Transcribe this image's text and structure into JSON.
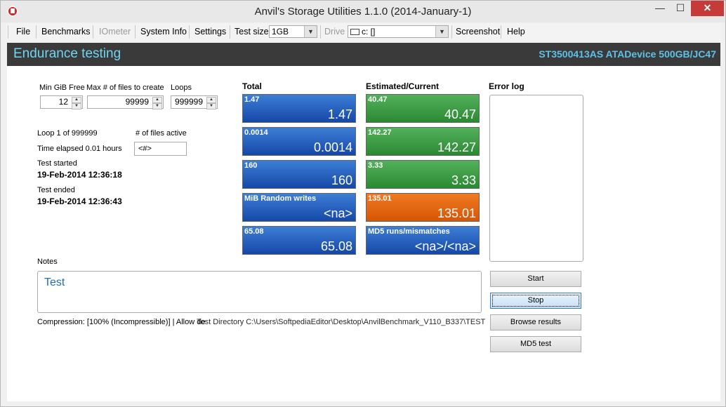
{
  "window": {
    "title": "Anvil's Storage Utilities 1.1.0 (2014-January-1)",
    "min": "—",
    "max": "☐",
    "close": "✕"
  },
  "menu": {
    "file": "File",
    "benchmarks": "Benchmarks",
    "iometer": "IOmeter",
    "sysinfo": "System Info",
    "settings": "Settings",
    "testsize_label": "Test size",
    "testsize_value": "1GB",
    "drive_label": "Drive",
    "drive_value": "c: []",
    "screenshot": "Screenshot",
    "help": "Help"
  },
  "header": {
    "title": "Endurance testing",
    "device": "ST3500413AS ATADevice 500GB/JC47"
  },
  "params": {
    "min_gib_label": "Min GiB Free",
    "min_gib_value": "12",
    "max_files_label": "Max # of files to create",
    "max_files_value": "99999",
    "loops_label": "Loops",
    "loops_value": "999999"
  },
  "info": {
    "loop": "Loop 1 of 999999",
    "elapsed": "Time elapsed 0.01 hours",
    "files_active_label": "# of files active",
    "files_active_value": "<#>",
    "started_label": "Test started",
    "started_value": "19-Feb-2014 12:36:18",
    "ended_label": "Test ended",
    "ended_value": "19-Feb-2014 12:36:43"
  },
  "total": {
    "heading": "Total",
    "tiles": [
      {
        "top": "1.47",
        "big": "1.47"
      },
      {
        "top": "0.0014",
        "big": "0.0014"
      },
      {
        "top": "160",
        "big": "160"
      },
      {
        "top": "MiB Random writes",
        "big": "<na>"
      },
      {
        "top": "65.08",
        "big": "65.08"
      }
    ]
  },
  "estimated": {
    "heading": "Estimated/Current",
    "tiles": [
      {
        "top": "40.47",
        "big": "40.47"
      },
      {
        "top": "142.27",
        "big": "142.27"
      },
      {
        "top": "3.33",
        "big": "3.33"
      },
      {
        "top": "135.01",
        "big": "135.01"
      },
      {
        "top": "MD5 runs/mismatches",
        "big": "<na>/<na>"
      }
    ]
  },
  "errorlog": {
    "heading": "Error log"
  },
  "notes": {
    "label": "Notes",
    "value": "Test"
  },
  "buttons": {
    "start": "Start",
    "stop": "Stop",
    "browse": "Browse results",
    "md5": "MD5 test"
  },
  "status": {
    "line": "Compression: [100% (Incompressible)] | Allow de",
    "overlap": "Test Directory C:\\Users\\SoftpediaEditor\\Desktop\\AnvilBenchmark_V110_B337\\TEST"
  },
  "colors": {
    "blue_tile": "#1f5fc0",
    "green_tile": "#3a9c42",
    "orange_tile": "#e8650f",
    "header_text": "#6fd6f2"
  }
}
